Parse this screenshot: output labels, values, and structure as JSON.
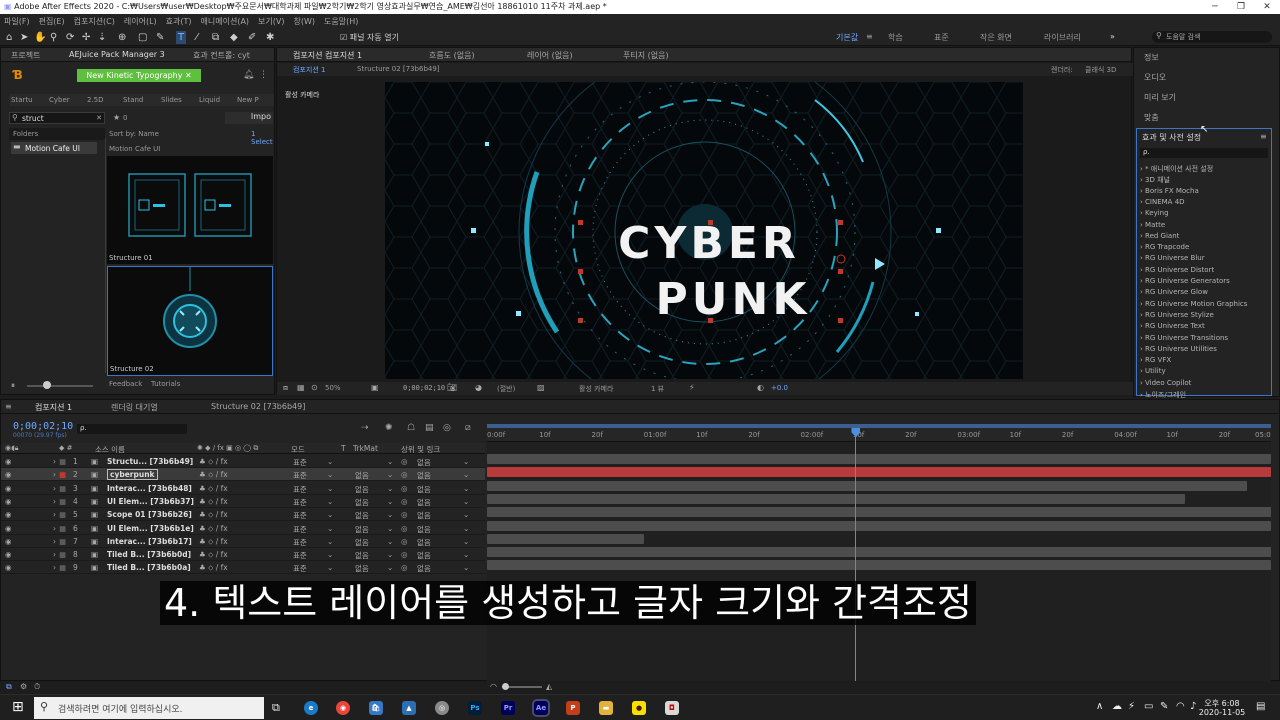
{
  "window": {
    "title": "Adobe After Effects 2020 - C:₩Users₩user₩Desktop₩주요문서₩대학과제 파일₩2학기₩2학기 영상효과실무₩연습_AME₩김선아 18861010 11주차 과제.aep *",
    "minimize": "─",
    "maximize": "❐",
    "close": "✕"
  },
  "menu": [
    "파일(F)",
    "편집(E)",
    "컴포지션(C)",
    "레이어(L)",
    "효과(T)",
    "애니메이션(A)",
    "보기(V)",
    "창(W)",
    "도움말(H)"
  ],
  "toolbar": {
    "snap_label": "패널 자동 열기",
    "workspaces": [
      "기본값",
      "≡",
      "학습",
      "표준",
      "작은 화면",
      "라이브러리"
    ],
    "search_placeholder": "도움말 검색",
    "more": "»"
  },
  "project_panel": {
    "tabs": [
      "프로젝트",
      "AEJuice Pack Manager 3",
      "효과 컨트롤: cyt"
    ],
    "plugin_button": "New Kinetic Typography",
    "category_tabs": [
      "Startu",
      "Cyber",
      "2.5D",
      "Stand",
      "Slides",
      "Liquid",
      "New P"
    ],
    "search_value": "struct",
    "star_count": "0",
    "import_label": "Impo",
    "folders_header": "Folders",
    "sort_label": "Sort by: Name",
    "select_label": "1 Select",
    "folder": "Motion Cafe UI",
    "breadcrumb": "Motion Cafe UI",
    "thumbs": [
      "Structure 01",
      "Structure 02"
    ],
    "footer": [
      "Feedback",
      "Tutorials"
    ]
  },
  "comp_panel": {
    "tabs": [
      "컴포지션 컴포지션 1",
      "흐름도 (없음)",
      "레이어 (없음)",
      "푸티지 (없음)"
    ],
    "subtabs": [
      "컴포지션 1",
      "Structure 02 [73b6b49]"
    ],
    "renderer": "렌더러:",
    "renderer_value": "클래식 3D",
    "camera_label": "활성 카메라",
    "title_line1": "CYBER",
    "title_line2": "PUNK",
    "footer": {
      "zoom": "50%",
      "timecode": "0;00;02;10",
      "resolution": "(절반)",
      "camera": "활성 카메라",
      "view": "1 뷰",
      "exposure": "+0.0"
    }
  },
  "right_panel": {
    "items": [
      "정보",
      "오디오",
      "미리 보기",
      "맞춤"
    ],
    "effects_title": "효과 및 사전 설정",
    "effects_menu": "≡",
    "search_placeholder": "ρ.",
    "effects": [
      "* 애니메이션 사전 설정",
      "3D 채널",
      "Boris FX Mocha",
      "CINEMA 4D",
      "Keying",
      "Matte",
      "Red Giant",
      "RG Trapcode",
      "RG Universe Blur",
      "RG Universe Distort",
      "RG Universe Generators",
      "RG Universe Glow",
      "RG Universe Motion Graphics",
      "RG Universe Stylize",
      "RG Universe Text",
      "RG Universe Transitions",
      "RG Universe Utilities",
      "RG VFX",
      "Utility",
      "Video Copilot",
      "노이즈/그레인"
    ]
  },
  "timeline": {
    "tabs": [
      "컴포지션 1",
      "렌더링 대기열",
      "Structure 02 [73b6b49]"
    ],
    "timecode": "0;00;02;10",
    "fps": "00070 (29.97 fps)",
    "search_placeholder": "ρ.",
    "headers": {
      "name": "소스 이름",
      "mode": "모드",
      "t": "T",
      "trkmat": "TrkMat",
      "parent": "상위 및 링크"
    },
    "ruler": [
      "0:00f",
      "10f",
      "20f",
      "01:00f",
      "10f",
      "20f",
      "02:00f",
      "10f",
      "20f",
      "03:00f",
      "10f",
      "20f",
      "04:00f",
      "10f",
      "20f",
      "05:0"
    ],
    "current_time_fraction": 0.47,
    "layers": [
      {
        "num": "1",
        "name": "Structu... [73b6b49]",
        "mode": "표준",
        "trk": "",
        "parent": "없음",
        "color": "#5a5a5a",
        "bar": [
          0,
          1
        ],
        "selected": false
      },
      {
        "num": "2",
        "name": "cyberpunk",
        "mode": "표준",
        "trk": "없음",
        "parent": "없음",
        "color": "#c0392b",
        "bar": [
          0,
          1
        ],
        "selected": true
      },
      {
        "num": "3",
        "name": "Interac... [73b6b48]",
        "mode": "표준",
        "trk": "없음",
        "parent": "없음",
        "color": "#5a5a5a",
        "bar": [
          0,
          0.97
        ],
        "selected": false
      },
      {
        "num": "4",
        "name": "UI Elem... [73b6b37]",
        "mode": "표준",
        "trk": "없음",
        "parent": "없음",
        "color": "#5a5a5a",
        "bar": [
          0,
          0.89
        ],
        "selected": false
      },
      {
        "num": "5",
        "name": "Scope 01 [73b6b26]",
        "mode": "표준",
        "trk": "없음",
        "parent": "없음",
        "color": "#5a5a5a",
        "bar": [
          0,
          1
        ],
        "selected": false
      },
      {
        "num": "6",
        "name": "UI Elem... [73b6b1e]",
        "mode": "표준",
        "trk": "없음",
        "parent": "없음",
        "color": "#5a5a5a",
        "bar": [
          0,
          1
        ],
        "selected": false
      },
      {
        "num": "7",
        "name": "Interac... [73b6b17]",
        "mode": "표준",
        "trk": "없음",
        "parent": "없음",
        "color": "#5a5a5a",
        "bar": [
          0,
          0.2
        ],
        "selected": false
      },
      {
        "num": "8",
        "name": "Tiled B... [73b6b0d]",
        "mode": "표준",
        "trk": "없음",
        "parent": "없음",
        "color": "#5a5a5a",
        "bar": [
          0,
          1
        ],
        "selected": false
      },
      {
        "num": "9",
        "name": "Tiled B... [73b6b0a]",
        "mode": "표준",
        "trk": "없음",
        "parent": "없음",
        "color": "#5a5a5a",
        "bar": [
          0,
          1
        ],
        "selected": false
      }
    ]
  },
  "subtitle": "4. 텍스트 레이어를 생성하고 글자 크기와 간격조정",
  "taskbar": {
    "search_placeholder": "검색하려면 여기에 입력하십시오.",
    "time": "오후 6:08",
    "date": "2020-11-05",
    "apps": [
      "Ps",
      "Pr",
      "Ae"
    ]
  }
}
